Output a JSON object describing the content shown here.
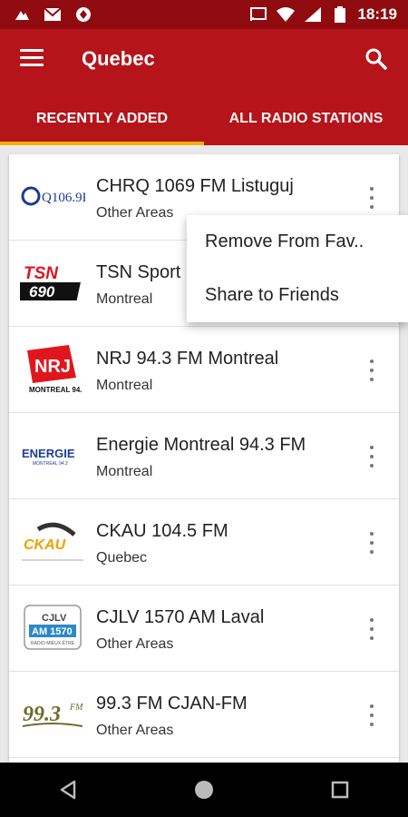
{
  "status_bar": {
    "time": "18:19",
    "left_icons": [
      "notification-icon",
      "gmail-icon",
      "app-icon"
    ],
    "right_icons": [
      "cast-icon",
      "wifi-icon",
      "signal-icon",
      "battery-icon"
    ]
  },
  "app_bar": {
    "title": "Quebec",
    "menu_icon": "menu-icon",
    "search_icon": "search-icon"
  },
  "tabs": [
    {
      "label": "RECENTLY ADDED",
      "active": true
    },
    {
      "label": "ALL RADIO STATIONS",
      "active": false
    }
  ],
  "stations": [
    {
      "name": "CHRQ 1069 FM Listuguj",
      "region": "Other Areas",
      "logo": "Q106.9FM"
    },
    {
      "name": "TSN Sport",
      "region": "Montreal",
      "logo": "TSN 690"
    },
    {
      "name": "NRJ 94.3 FM Montreal",
      "region": "Montreal",
      "logo": "NRJ"
    },
    {
      "name": "Energie Montreal 94.3 FM",
      "region": "Montreal",
      "logo": "ENERGIE"
    },
    {
      "name": "CKAU 104.5 FM",
      "region": "Quebec",
      "logo": "CKAU"
    },
    {
      "name": "CJLV 1570 AM Laval",
      "region": "Other Areas",
      "logo": "CJLV AM 1570"
    },
    {
      "name": "99.3 FM CJAN-FM",
      "region": "Other Areas",
      "logo": "99.3 FM"
    }
  ],
  "popup_menu": {
    "items": [
      "Remove From Fav..",
      "Share to Friends"
    ]
  },
  "nav_bar": {
    "buttons": [
      "back-icon",
      "home-icon",
      "recents-icon"
    ]
  },
  "colors": {
    "status_bar": "#8f0b10",
    "primary": "#b5141b",
    "tab_indicator": "#f0b400"
  }
}
